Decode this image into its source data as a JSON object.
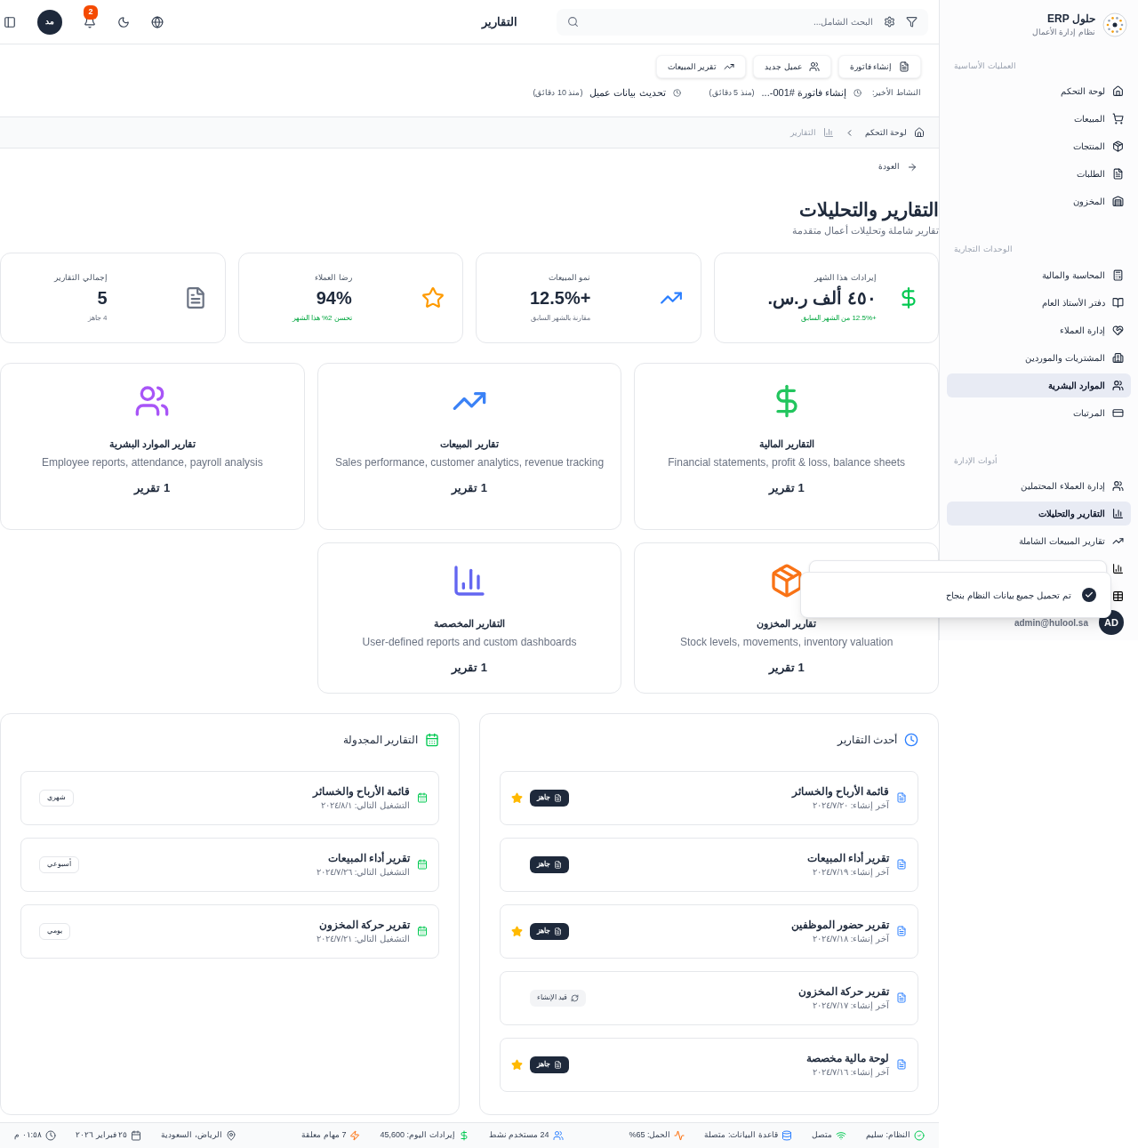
{
  "sidebar": {
    "brand": {
      "title": "حلول ERP",
      "subtitle": "نظام إدارة الأعمال"
    },
    "sections": [
      {
        "title": "العمليات الأساسية",
        "items": [
          {
            "label": "لوحة التحكم",
            "selected": false
          },
          {
            "label": "المبيعات",
            "selected": false
          },
          {
            "label": "المنتجات",
            "selected": false
          },
          {
            "label": "الطلبات",
            "selected": false
          },
          {
            "label": "المخزون",
            "selected": false
          }
        ]
      },
      {
        "title": "الوحدات التجارية",
        "items": [
          {
            "label": "المحاسبة والمالية",
            "selected": false
          },
          {
            "label": "دفتر الأستاذ العام",
            "selected": false
          },
          {
            "label": "إدارة العملاء",
            "selected": false
          },
          {
            "label": "المشتريات والموردين",
            "selected": false
          },
          {
            "label": "الموارد البشرية",
            "selected": true
          },
          {
            "label": "المرتبات",
            "selected": false
          }
        ]
      },
      {
        "title": "أدوات الإدارة",
        "items": [
          {
            "label": "إدارة العملاء المحتملين",
            "selected": false
          },
          {
            "label": "التقارير والتحليلات",
            "selected": true
          },
          {
            "label": "تقارير المبيعات الشاملة",
            "selected": false
          }
        ]
      }
    ],
    "user": {
      "initials": "AD",
      "email": "admin@hulool.sa"
    }
  },
  "toast": {
    "message": "تم تحميل جميع بيانات النظام بنجاح"
  },
  "header": {
    "title": "التقارير",
    "search_placeholder": "البحث الشامل...",
    "notification_count": "2",
    "avatar": "مد"
  },
  "quick_actions": [
    "إنشاء فاتورة",
    "عميل جديد",
    "تقرير المبيعات"
  ],
  "recent_activity": {
    "label": "النشاط الأخير:",
    "items": [
      {
        "text": "إنشاء فاتورة #001-...",
        "time": "(منذ 5 دقائق)"
      },
      {
        "text": "تحديث بيانات عميل",
        "time": "(منذ 10 دقائق)"
      }
    ]
  },
  "breadcrumb": [
    {
      "label": "لوحة التحكم",
      "selected": false
    },
    {
      "label": "التقارير",
      "selected": true
    }
  ],
  "back_link": "العودة",
  "page": {
    "title": "التقارير والتحليلات",
    "subtitle": "تقارير شاملة وتحليلات أعمال متقدمة"
  },
  "stats": [
    {
      "label": "إيرادات هذا الشهر",
      "value": "٤٥٠ ألف ر.س.",
      "note": "+12.5% من الشهر السابق",
      "positive": true
    },
    {
      "label": "نمو المبيعات",
      "value": "+12.5%",
      "note": "مقارنة بالشهر السابق",
      "positive": false
    },
    {
      "label": "رضا العملاء",
      "value": "94%",
      "note": "تحسن 2% هذا الشهر",
      "positive": true
    },
    {
      "label": "إجمالي التقارير",
      "value": "5",
      "note": "4 جاهز",
      "positive": false
    }
  ],
  "categories": [
    {
      "title": "التقارير المالية",
      "description": "Financial statements, profit & loss, balance sheets",
      "count": "1 تقرير",
      "color": "#22c55e"
    },
    {
      "title": "تقارير المبيعات",
      "description": "Sales performance, customer analytics, revenue tracking",
      "count": "1 تقرير",
      "color": "#3b82f6"
    },
    {
      "title": "تقارير الموارد البشرية",
      "description": "Employee reports, attendance, payroll analysis",
      "count": "1 تقرير",
      "color": "#a855f7"
    },
    {
      "title": "تقارير المخزون",
      "description": "Stock levels, movements, inventory valuation",
      "count": "1 تقرير",
      "color": "#f97316"
    },
    {
      "title": "التقارير المخصصة",
      "description": "User-defined reports and custom dashboards",
      "count": "1 تقرير",
      "color": "#6366f1"
    }
  ],
  "recent_reports": {
    "title": "أحدث التقارير",
    "items": [
      {
        "name": "قائمة الأرباح والخسائر",
        "date": "آخر إنشاء: ٢٠٢٤/٧/٢٠",
        "status": "جاهز",
        "kind": "ready",
        "starred": true
      },
      {
        "name": "تقرير أداء المبيعات",
        "date": "آخر إنشاء: ٢٠٢٤/٧/١٩",
        "status": "جاهز",
        "kind": "ready",
        "starred": false
      },
      {
        "name": "تقرير حضور الموظفين",
        "date": "آخر إنشاء: ٢٠٢٤/٧/١٨",
        "status": "جاهز",
        "kind": "ready",
        "starred": true
      },
      {
        "name": "تقرير حركة المخزون",
        "date": "آخر إنشاء: ٢٠٢٤/٧/١٧",
        "status": "قيد الإنشاء",
        "kind": "generating",
        "starred": false
      },
      {
        "name": "لوحة مالية مخصصة",
        "date": "آخر إنشاء: ٢٠٢٤/٧/١٦",
        "status": "جاهز",
        "kind": "ready",
        "starred": true
      }
    ]
  },
  "scheduled_reports": {
    "title": "التقارير المجدولة",
    "items": [
      {
        "name": "قائمة الأرباح والخسائر",
        "next_run": "التشغيل التالي: ٢٠٢٤/٨/١",
        "frequency": "شهري"
      },
      {
        "name": "تقرير أداء المبيعات",
        "next_run": "التشغيل التالي: ٢٠٢٤/٧/٢٦",
        "frequency": "أسبوعي"
      },
      {
        "name": "تقرير حركة المخزون",
        "next_run": "التشغيل التالي: ٢٠٢٤/٧/٢١",
        "frequency": "يومي"
      }
    ]
  },
  "status_bar": {
    "system": [
      "النظام: سليم",
      "متصل",
      "قاعدة البيانات: متصلة",
      "الحمل: 65%"
    ],
    "activity": [
      "24 مستخدم نشط",
      "إيرادات اليوم: 45,600",
      "7 مهام معلقة"
    ],
    "locale": [
      "الرياض، السعودية",
      "٢٥ فبراير ٢٠٢٦",
      "٠١:٥٨ م"
    ]
  }
}
